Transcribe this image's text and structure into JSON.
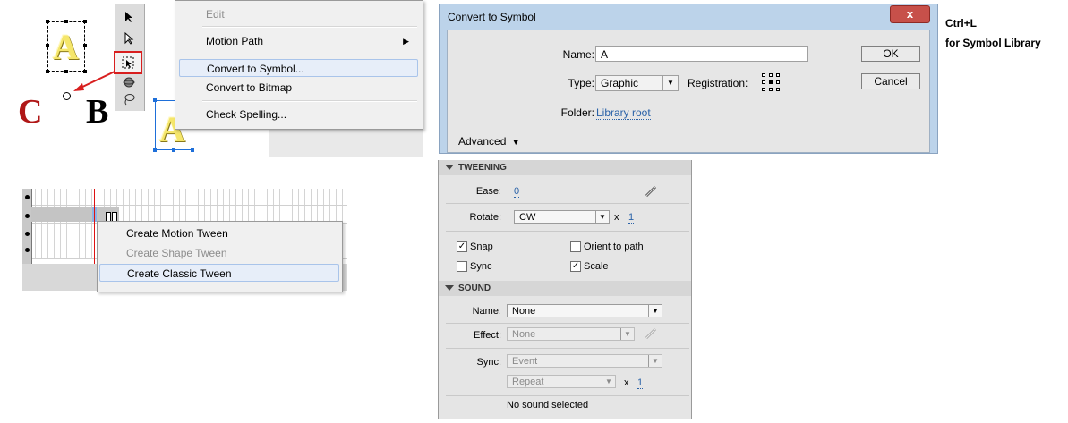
{
  "context_menu": {
    "items": [
      {
        "label": "Edit",
        "disabled": true
      },
      {
        "label": "Motion Path",
        "submenu": true
      },
      {
        "label": "Convert to Symbol...",
        "selected": true
      },
      {
        "label": "Convert to Bitmap"
      },
      {
        "label": "Check Spelling..."
      }
    ]
  },
  "stage": {
    "symbol_letter": "A",
    "label_c": "C",
    "label_b": "B"
  },
  "dialog": {
    "title": "Convert to Symbol",
    "close_glyph": "x",
    "name_label": "Name:",
    "name_value": "A",
    "type_label": "Type:",
    "type_value": "Graphic",
    "registration_label": "Registration:",
    "folder_label": "Folder:",
    "folder_value": "Library root",
    "advanced_label": "Advanced",
    "ok_label": "OK",
    "cancel_label": "Cancel"
  },
  "note": {
    "shortcut": "Ctrl+L",
    "text": "for Symbol Library"
  },
  "timeline_menu": {
    "items": [
      {
        "label": "Create Motion Tween"
      },
      {
        "label": "Create Shape Tween",
        "disabled": true
      },
      {
        "label": "Create Classic Tween",
        "selected": true
      }
    ]
  },
  "properties": {
    "tweening": {
      "header": "TWEENING",
      "ease_label": "Ease:",
      "ease_value": "0",
      "rotate_label": "Rotate:",
      "rotate_value": "CW",
      "times_label": "x",
      "rotate_count": "1",
      "snap_label": "Snap",
      "snap_checked": true,
      "orient_label": "Orient to path",
      "orient_checked": false,
      "sync_label": "Sync",
      "sync_checked": false,
      "scale_label": "Scale",
      "scale_checked": true
    },
    "sound": {
      "header": "SOUND",
      "name_label": "Name:",
      "name_value": "None",
      "effect_label": "Effect:",
      "effect_value": "None",
      "sync_label": "Sync:",
      "sync_value": "Event",
      "repeat_value": "Repeat",
      "times_label": "x",
      "repeat_count": "1",
      "status": "No sound selected"
    }
  },
  "colors": {
    "highlight_red": "#d81f1f",
    "link_blue": "#2a62a8",
    "dialog_frame": "#bcd3ea"
  }
}
